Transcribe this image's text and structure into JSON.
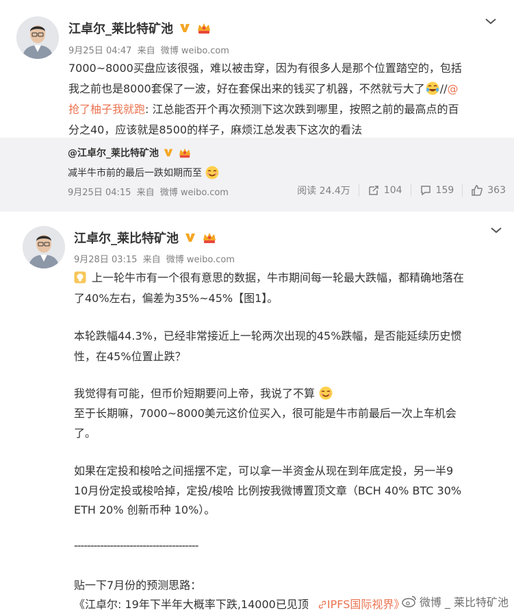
{
  "post1": {
    "author": "江卓尔_莱比特矿池",
    "date": "9月25日 04:47",
    "source_prefix": "来自",
    "source": "微博 weibo.com",
    "lines": [
      {
        "text": "7000~8000买盘应该很强，难以被击穿，因为有很多人是那个位置踏空的，包括"
      },
      {
        "text": "我之前也是8000套保了一波，好在套保出来的钱买了机器，不然就亏大了",
        "tail": "//",
        "link": "@"
      },
      {
        "link": "抢了柚子我就跑",
        "text": ": 江总能否开个再次预测下这次跌到哪里，按照之前的最高点的百"
      },
      {
        "text": "分之40，应该就是8500的样子，麻烦江总发表下这次的看法"
      }
    ],
    "quote": {
      "author": "@江卓尔_莱比特矿池",
      "text": "减半牛市前的最后一跌如期而至",
      "date": "9月25日 04:15",
      "source_prefix": "来自",
      "source": "微博 weibo.com",
      "reads_label": "阅读 24.4万",
      "reposts": "104",
      "comments": "159",
      "likes": "363"
    }
  },
  "post2": {
    "author": "江卓尔_莱比特矿池",
    "date": "9月28日 03:15",
    "source_prefix": "来自",
    "source": "微博 weibo.com",
    "p1_line1": "上一轮牛市有一个很有意思的数据，牛市期间每一轮最大跌幅，都精确地落在",
    "p1_line2": "了40%左右，偏差为35%~45%【图1】。",
    "p2_line1": "本轮跌幅44.3%，已经非常接近上一轮两次出现的45%跌幅，是否能延续历史惯",
    "p2_line2": "性，在45%位置止跌？",
    "p3_line1": "我觉得有可能，但币价短期要问上帝，我说了不算",
    "p3_line2": "至于长期嘛，7000~8000美元这价位买入，很可能是牛市前最后一次上车机会",
    "p3_line3": "了。",
    "p4_line1": "如果在定投和梭哈之间摇摆不定，可以拿一半资金从现在到年底定投，另一半9",
    "p4_line2": "10月份定投或梭哈掉，定投/梭哈 比例按我微博置顶文章（BCH 40% BTC 30%",
    "p4_line3": "ETH 20% 创新币种 10%）。",
    "divider": "--------------------------------------",
    "p5_line1": "贴一下7月份的预测思路：",
    "p5_line2": "《江卓尔: 19年下半年大概率下跌,14000已见顶",
    "p5_link": "IPFS国际视界》"
  },
  "watermark": "微博 _ 莱比特矿池",
  "colors": {
    "link": "#eb7350",
    "gold": "#f5a623",
    "grey_bg": "#f2f2f5"
  }
}
